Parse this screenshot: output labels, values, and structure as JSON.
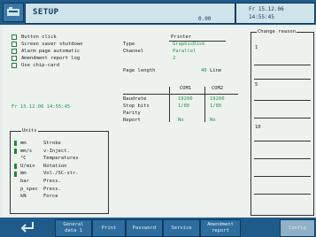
{
  "header": {
    "title": "SETUP",
    "number": "0.00",
    "date": "Fr 15.12.06",
    "time": "14:55:45"
  },
  "options": [
    {
      "label": "Button click"
    },
    {
      "label": "Screen saver shutdown"
    },
    {
      "label": "Alarm page automatic"
    },
    {
      "label": "Amendment report log"
    },
    {
      "label": "Use chip-card"
    }
  ],
  "datetime_field": "Fr 15.12.06 14:55:45",
  "units": {
    "title": "Units",
    "rows": [
      {
        "symbol": "mm",
        "name": "Stroke",
        "active": true
      },
      {
        "symbol": "mm/s",
        "name": "v-Inject.",
        "active": true
      },
      {
        "symbol": "°C",
        "name": "Temperatures",
        "active": false
      },
      {
        "symbol": "U/min",
        "name": "Rotation",
        "active": true
      },
      {
        "symbol": "mm",
        "name": "Vol./SC-str.",
        "active": true
      },
      {
        "symbol": "bar",
        "name": "Press.",
        "active": false
      },
      {
        "symbol": "p_spec",
        "name": "Press.",
        "active": false
      },
      {
        "symbol": "kN",
        "name": "Force",
        "active": false
      }
    ]
  },
  "printer": {
    "heading": "Printer",
    "type_label": "Type",
    "type_value": "GraphicDisk",
    "channel_label": "Channel",
    "channel_value": "Parallel 2",
    "page_length_label": "Page length",
    "page_length_value": "40",
    "page_length_unit": "Line"
  },
  "com": {
    "headers": [
      "COM1",
      "COM2"
    ],
    "rows": [
      {
        "label": "Baudrate",
        "com1": "19200",
        "com2": "19200"
      },
      {
        "label": "Stop bits",
        "com1": "1/80",
        "com2": "1/80"
      },
      {
        "label": "Parity",
        "com1": "",
        "com2": ""
      },
      {
        "label": "Report",
        "com1": "No",
        "com2": "No"
      }
    ]
  },
  "change_reason": {
    "title": "Change reason",
    "entries": [
      "1",
      "5",
      "10"
    ]
  },
  "softkeys": [
    {
      "label_1": "General",
      "label_2": "data 1"
    },
    {
      "label_1": "Print",
      "label_2": ""
    },
    {
      "label_1": "Password",
      "label_2": ""
    },
    {
      "label_1": "Service",
      "label_2": ""
    },
    {
      "label_1": "Amendment",
      "label_2": "report"
    },
    {
      "label_1": "Config",
      "label_2": ""
    }
  ],
  "colors": {
    "title_bar": "#1e5a8a",
    "value_green": "#1a9a4a",
    "panel_bg": "#eef2ef"
  }
}
